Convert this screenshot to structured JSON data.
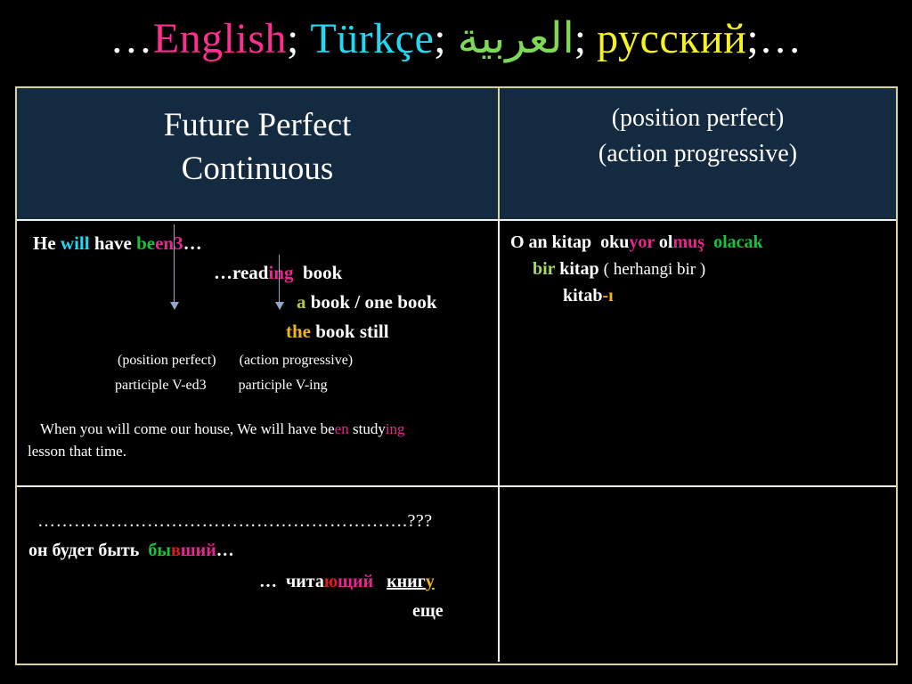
{
  "header": {
    "lead_ellipsis": "…",
    "languages": [
      {
        "name": "English",
        "color": "#ff2d8f"
      },
      {
        "name": "Türkçe",
        "color": "#22d8f2"
      },
      {
        "name": "العربية",
        "color": "#7ed957"
      },
      {
        "name": "русский",
        "color": "#f6f224"
      }
    ],
    "separator": ";",
    "trail_ellipsis": "…"
  },
  "table": {
    "header_row": {
      "tense_title_line1": "Future Perfect",
      "tense_title_line2": "Continuous",
      "aspect_line1": "(position perfect)",
      "aspect_line2": "(action progressive)"
    },
    "english_cell": {
      "line1": {
        "he": "He",
        "will": "will",
        "have": "have",
        "be": "be",
        "en3": "en3",
        "ellipsis": "…"
      },
      "line2": {
        "ellipsis": "…",
        "read": "read",
        "ing": "ing",
        "book": "book"
      },
      "line3": {
        "article": "a",
        "rest": "book / one book"
      },
      "line4": {
        "article": "the",
        "rest": "book still"
      },
      "labels": {
        "position_perfect": "(position perfect)",
        "action_progressive": "(action progressive)",
        "participle_ved3": "participle V-ed3",
        "participle_ving": "participle V-ing"
      },
      "example": {
        "part1": "When you will come our house, We will have be",
        "en": "en",
        "part2": " study",
        "ing": "ing",
        "part3": "lesson that  time."
      }
    },
    "turkish_cell": {
      "line1": {
        "o_an_kitap": "O an  kitap",
        "oku": "oku",
        "yor": "yor",
        "ol": "ol",
        "mus": "muş",
        "olacak": "olacak"
      },
      "line2": {
        "bir": "bir",
        "kitap": "kitap",
        "paren": "( herhangi bir )"
      },
      "line3": {
        "kitab": "kitab",
        "suffix": "-ı"
      }
    },
    "russian_cell": {
      "dots": "…………………………………………………….",
      "question_marks": "???",
      "line1": {
        "on_budet_byt": "он   будет  быть",
        "by": "бы",
        "v": "в",
        "shiy": "ший",
        "ellipsis": "…"
      },
      "line2": {
        "ellipsis": "…",
        "chita": "чита",
        "yu": "ю",
        "shchiy": "щий",
        "knig": "книг",
        "u": "у"
      },
      "line3": {
        "eshche": "еще"
      }
    },
    "empty_cell_note": ""
  },
  "colors": {
    "table_border": "#d6d49a",
    "header_cell_bg": "#142a40",
    "inner_divider": "#f3f3e7",
    "arrow": "#8fa8c8",
    "page_bg": "#000000"
  }
}
